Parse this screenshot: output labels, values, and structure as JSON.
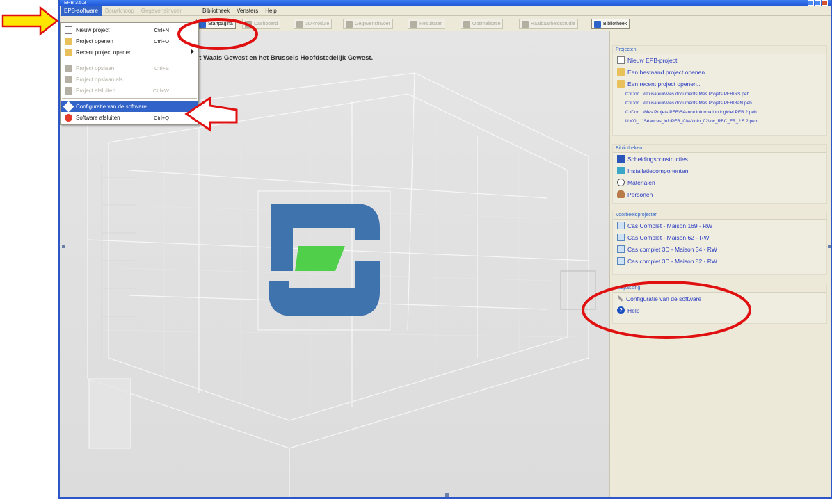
{
  "window": {
    "title": "EPB 3.5.3"
  },
  "menubar": {
    "items": [
      {
        "label": "EPB-software",
        "state": "active"
      },
      {
        "label": "Bouwknoop",
        "state": "disabled"
      },
      {
        "label": "Gegevensinvoer",
        "state": "disabled"
      },
      {
        "label": "Bibliotheek",
        "state": "normal"
      },
      {
        "label": "Vensters",
        "state": "normal"
      },
      {
        "label": "Help",
        "state": "normal"
      }
    ]
  },
  "toolbar": {
    "buttons": [
      {
        "label": "Startpagina",
        "enabled": true
      },
      {
        "label": "Dashboard",
        "enabled": false
      },
      {
        "label": "3D-module",
        "enabled": false
      },
      {
        "label": "Gegevensinvoer",
        "enabled": false
      },
      {
        "label": "Resultaten",
        "enabled": false
      },
      {
        "label": "Optimalisatie",
        "enabled": false
      },
      {
        "label": "Haalbaarheidsstudie",
        "enabled": false
      },
      {
        "label": "Bibliotheek",
        "enabled": true
      }
    ]
  },
  "dropdown": {
    "items": [
      {
        "label": "Nieuw project",
        "shortcut": "Ctrl+N",
        "icon": "new-page-icon",
        "state": "normal"
      },
      {
        "label": "Project openen",
        "shortcut": "Ctrl+O",
        "icon": "folder-icon",
        "state": "normal"
      },
      {
        "label": "Recent project openen",
        "shortcut": "",
        "icon": "folder-icon",
        "state": "normal",
        "submenu": true
      },
      {
        "sep": true
      },
      {
        "label": "Project opslaan",
        "shortcut": "Ctrl+S",
        "icon": "save-icon",
        "state": "disabled"
      },
      {
        "label": "Project opslaan als...",
        "shortcut": "",
        "icon": "save-as-icon",
        "state": "disabled"
      },
      {
        "label": "Project afsluiten",
        "shortcut": "Ctrl+W",
        "icon": "close-x-icon",
        "state": "disabled"
      },
      {
        "sep": true
      },
      {
        "label": "Configuratie van de software",
        "shortcut": "",
        "icon": "wrench-icon",
        "state": "highlighted"
      },
      {
        "label": "Software afsluiten",
        "shortcut": "Ctrl+Q",
        "icon": "exit-icon",
        "state": "normal"
      }
    ]
  },
  "canvas": {
    "region_title": "et Waals Gewest en het Brussels Hoofdstedelijk Gewest."
  },
  "panel": {
    "projecten": {
      "title": "Projecten",
      "actions": [
        "Nieuw EPB-project",
        "Een bestaand project openen",
        "Een recent project openen..."
      ],
      "recent": [
        "C:\\Doc...\\Utilisateur\\Mes documents\\Mes Projets PEB\\RS.peb",
        "C:\\Doc...\\Utilisateur\\Mes documents\\Mes Projets PEB\\BaN.peb",
        "C:\\Doc...\\Mes Projets PEB\\Séance information logiciel PEB 2.peb",
        "U:\\00_...\\Séances_infoPEB_Civa\\Info_02\\loc_RBC_FR_2.5.2.peb"
      ]
    },
    "bibliotheken": {
      "title": "Bibliotheken",
      "items": [
        "Scheidingsconstructies",
        "Installatiecomponenten",
        "Materialen",
        "Personen"
      ]
    },
    "voorbeeld": {
      "title": "Voorbeeldprojecten",
      "items": [
        "Cas Complet - Maison 169 - RW",
        "Cas Complet - Maison 62 - RW",
        "Cas complet 3D - Maison 34 - RW",
        "Cas complet 3D - Maison 82 - RW"
      ]
    },
    "toepassing": {
      "title": "Toepassing",
      "items": [
        "Configuratie van de software",
        "Help"
      ]
    }
  },
  "colors": {
    "accent": "#3163c9",
    "annotation_red": "#e01010",
    "arrow_yellow": "#ffe600",
    "logo_blue": "#3f73ad",
    "logo_green": "#4fcf4a"
  }
}
